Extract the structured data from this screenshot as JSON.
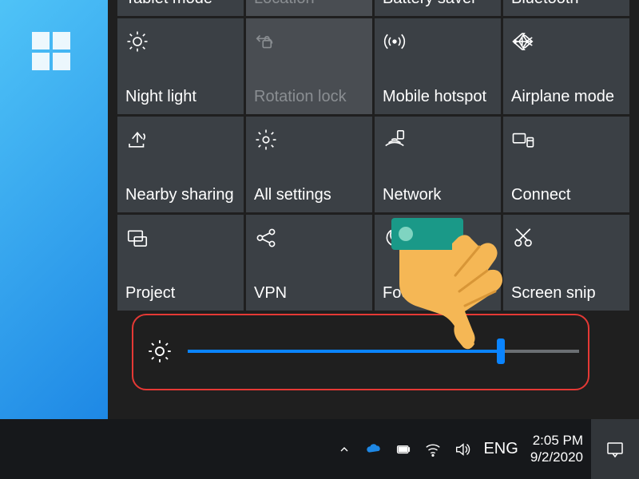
{
  "tiles": [
    {
      "label": "Tablet mode",
      "disabled": false
    },
    {
      "label": "Location",
      "disabled": true
    },
    {
      "label": "Battery saver",
      "disabled": false
    },
    {
      "label": "Bluetooth",
      "disabled": false
    },
    {
      "label": "Night light",
      "disabled": false
    },
    {
      "label": "Rotation lock",
      "disabled": true
    },
    {
      "label": "Mobile hotspot",
      "disabled": false
    },
    {
      "label": "Airplane mode",
      "disabled": false
    },
    {
      "label": "Nearby sharing",
      "disabled": false
    },
    {
      "label": "All settings",
      "disabled": false
    },
    {
      "label": "Network",
      "disabled": false
    },
    {
      "label": "Connect",
      "disabled": false
    },
    {
      "label": "Project",
      "disabled": false
    },
    {
      "label": "VPN",
      "disabled": false
    },
    {
      "label": "Focus assist",
      "disabled": false
    },
    {
      "label": "Screen snip",
      "disabled": false
    }
  ],
  "brightness": {
    "percent": 80
  },
  "taskbar": {
    "lang": "ENG",
    "time": "2:05 PM",
    "date": "9/2/2020"
  },
  "colors": {
    "accent": "#0a84ff",
    "highlight": "#e53935",
    "tile": "#3b4045",
    "tileDisabled": "#494d52"
  }
}
